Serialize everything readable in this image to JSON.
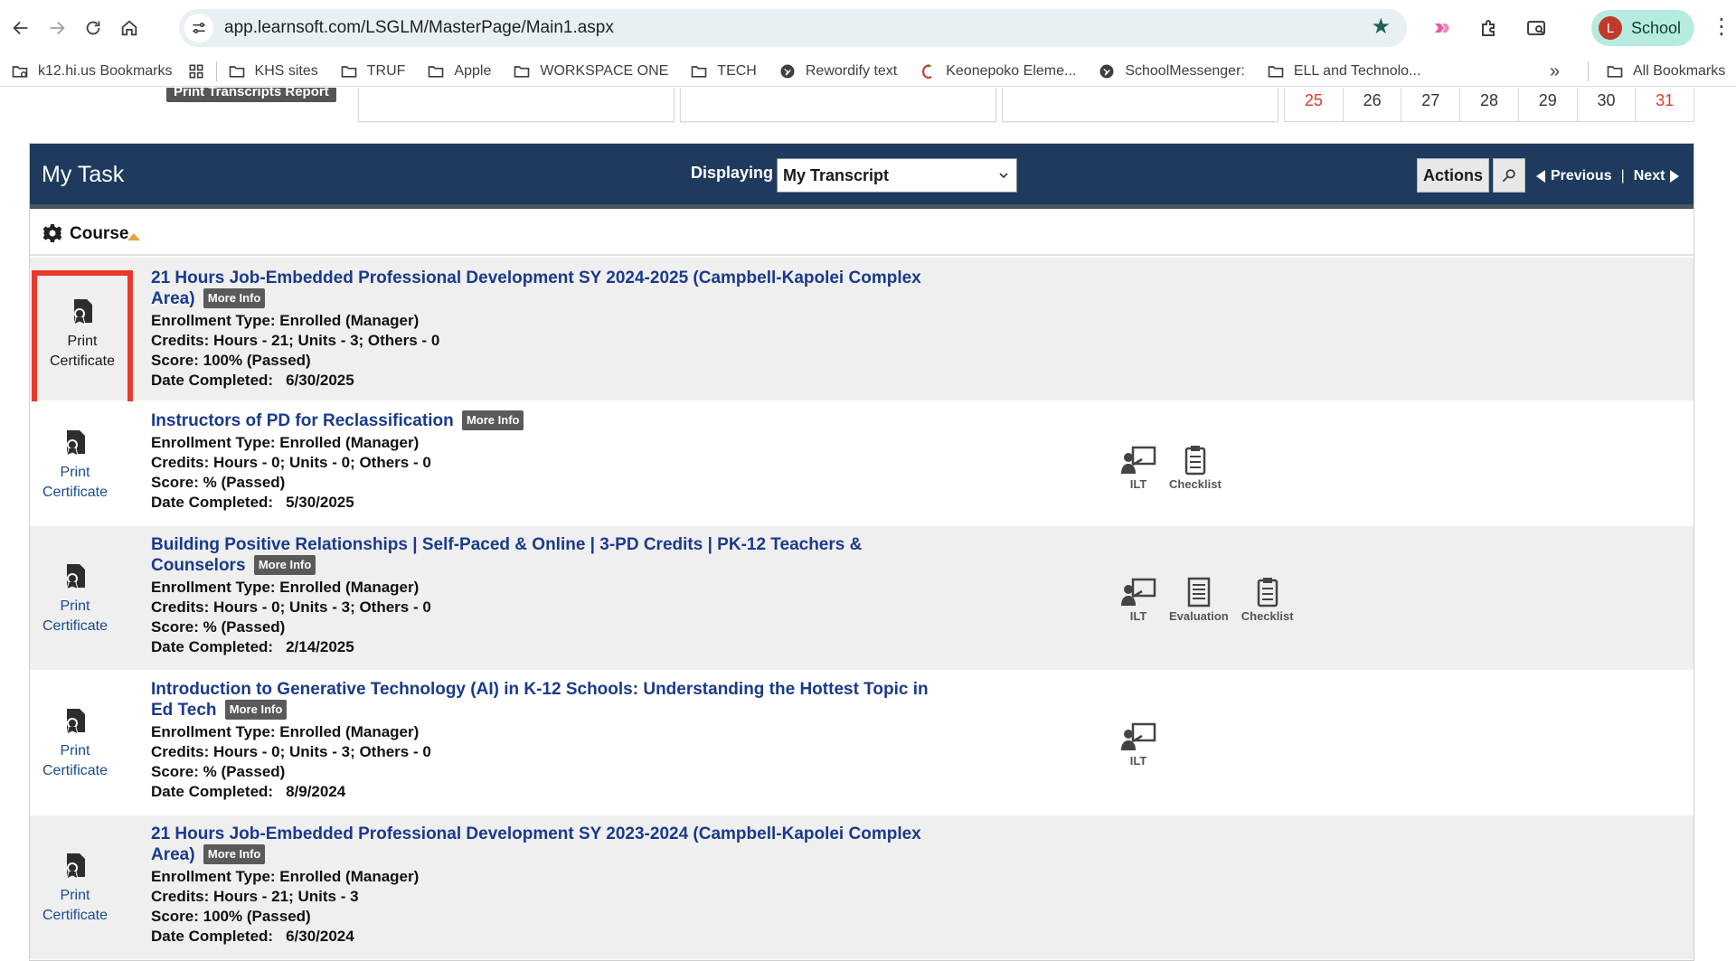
{
  "browser": {
    "url": "app.learnsoft.com/LSGLM/MasterPage/Main1.aspx",
    "profile_initial": "L",
    "profile_name": "School",
    "bookmarks": [
      {
        "label": "k12.hi.us Bookmarks",
        "icon": "bookmark-folder-icon"
      },
      {
        "label": "KHS sites",
        "icon": "folder-icon"
      },
      {
        "label": "TRUF",
        "icon": "folder-icon"
      },
      {
        "label": "Apple",
        "icon": "folder-icon"
      },
      {
        "label": "WORKSPACE ONE",
        "icon": "folder-icon"
      },
      {
        "label": "TECH",
        "icon": "folder-icon"
      },
      {
        "label": "Rewordify text",
        "icon": "globe-icon"
      },
      {
        "label": "Keonepoko Eleme...",
        "icon": "keonepoko-icon"
      },
      {
        "label": "SchoolMessenger:",
        "icon": "globe-icon"
      },
      {
        "label": "ELL and Technolo...",
        "icon": "folder-icon"
      }
    ],
    "all_bookmarks": "All Bookmarks",
    "overflow": "»"
  },
  "top_strip": {
    "print_transcripts_label": "Print Transcripts Report",
    "calendar_days": [
      {
        "day": "25",
        "weekend": true
      },
      {
        "day": "26",
        "weekend": false
      },
      {
        "day": "27",
        "weekend": false
      },
      {
        "day": "28",
        "weekend": false
      },
      {
        "day": "29",
        "weekend": false
      },
      {
        "day": "30",
        "weekend": false
      },
      {
        "day": "31",
        "weekend": true
      }
    ]
  },
  "panel": {
    "title": "My Task",
    "displaying_label": "Displaying",
    "displaying_value": "My Transcript",
    "actions_label": "Actions",
    "previous_label": "Previous",
    "next_label": "Next",
    "pager_sep": "|",
    "sort_label": "Course"
  },
  "colors": {
    "header_bg": "#1e3a5f",
    "title_link": "#1a3a8c",
    "highlight_border": "#e8392b",
    "row_alt": "#efefef"
  },
  "courses": [
    {
      "title": "21 Hours Job-Embedded Professional Development SY 2024-2025 (Campbell-Kapolei Complex Area)",
      "more_info": "More Info",
      "print_line1": "Print",
      "print_line2": "Certificate",
      "enrollment": "Enrollment Type: Enrolled (Manager)",
      "credits": "Credits: Hours - 21; Units - 3; Others - 0",
      "score": "Score: 100%  (Passed)",
      "date_label": "Date Completed:",
      "date": "6/30/2025",
      "icons": []
    },
    {
      "title": "Instructors of PD for Reclassification",
      "more_info": "More Info",
      "print_line1": "Print",
      "print_line2": "Certificate",
      "enrollment": "Enrollment Type: Enrolled (Manager)",
      "credits": "Credits: Hours - 0; Units - 0; Others - 0",
      "score": "Score: %  (Passed)",
      "date_label": "Date Completed:",
      "date": "5/30/2025",
      "icons": [
        "ILT",
        "Checklist"
      ]
    },
    {
      "title": "Building Positive Relationships | Self-Paced & Online | 3-PD Credits | PK-12 Teachers & Counselors",
      "more_info": "More Info",
      "print_line1": "Print",
      "print_line2": "Certificate",
      "enrollment": "Enrollment Type: Enrolled (Manager)",
      "credits": "Credits: Hours - 0; Units - 3; Others - 0",
      "score": "Score: %  (Passed)",
      "date_label": "Date Completed:",
      "date": "2/14/2025",
      "icons": [
        "ILT",
        "Evaluation",
        "Checklist"
      ]
    },
    {
      "title": "Introduction to Generative Technology (AI) in K-12 Schools: Understanding the Hottest Topic in Ed Tech",
      "more_info": "More Info",
      "print_line1": "Print",
      "print_line2": "Certificate",
      "enrollment": "Enrollment Type: Enrolled (Manager)",
      "credits": "Credits: Hours - 0; Units - 3; Others - 0",
      "score": "Score: %  (Passed)",
      "date_label": "Date Completed:",
      "date": "8/9/2024",
      "icons": [
        "ILT"
      ]
    },
    {
      "title": "21 Hours Job-Embedded Professional Development SY 2023-2024 (Campbell-Kapolei Complex Area)",
      "more_info": "More Info",
      "print_line1": "Print",
      "print_line2": "Certificate",
      "enrollment": "Enrollment Type: Enrolled (Manager)",
      "credits": "Credits: Hours - 21; Units - 3",
      "score": "Score: 100%  (Passed)",
      "date_label": "Date Completed:",
      "date": "6/30/2024",
      "icons": []
    }
  ]
}
